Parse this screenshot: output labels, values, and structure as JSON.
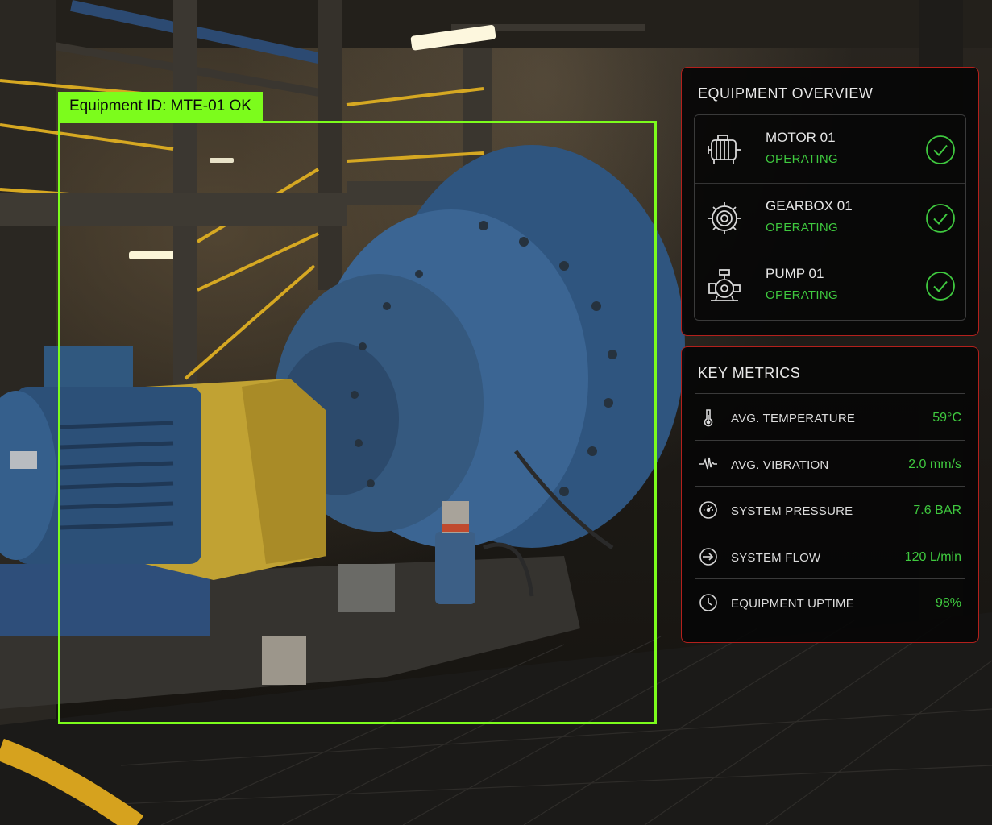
{
  "detection": {
    "label": "Equipment ID: MTE-01 OK",
    "box_color": "#7cfc1c"
  },
  "overview": {
    "title": "EQUIPMENT OVERVIEW",
    "items": [
      {
        "name": "MOTOR 01",
        "status": "OPERATING",
        "icon": "motor-icon"
      },
      {
        "name": "GEARBOX 01",
        "status": "OPERATING",
        "icon": "gearbox-icon"
      },
      {
        "name": "PUMP 01",
        "status": "OPERATING",
        "icon": "pump-icon"
      }
    ]
  },
  "metrics": {
    "title": "KEY METRICS",
    "items": [
      {
        "label": "AVG. TEMPERATURE",
        "value": "59°C",
        "icon": "thermometer-icon"
      },
      {
        "label": "AVG. VIBRATION",
        "value": "2.0 mm/s",
        "icon": "vibration-icon"
      },
      {
        "label": "SYSTEM PRESSURE",
        "value": "7.6 BAR",
        "icon": "pressure-gauge-icon"
      },
      {
        "label": "SYSTEM FLOW",
        "value": "120 L/min",
        "icon": "flow-icon"
      },
      {
        "label": "EQUIPMENT UPTIME",
        "value": "98%",
        "icon": "clock-icon"
      }
    ]
  },
  "colors": {
    "accent_green": "#3fc93f",
    "panel_border": "#b3201c",
    "detection_green": "#7cfc1c"
  }
}
